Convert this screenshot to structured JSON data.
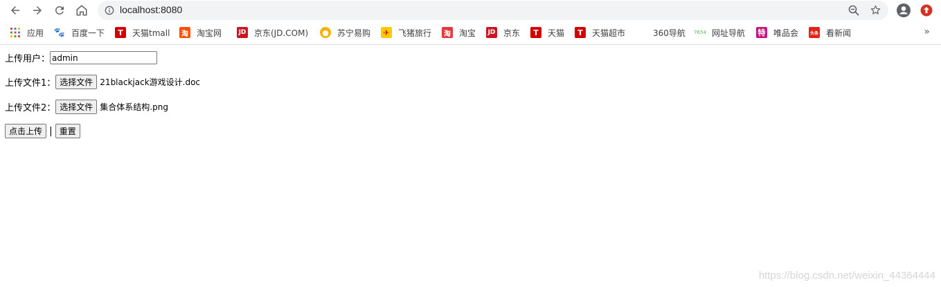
{
  "browser": {
    "url": "localhost:8080",
    "bookmarks": [
      {
        "label": "应用",
        "icon": "apps-grid-icon",
        "color": "#4285f4"
      },
      {
        "label": "百度一下",
        "icon": "baidu-paw-icon",
        "color": "#2932e1"
      },
      {
        "label": "天猫tmall",
        "icon": "tmall-icon",
        "color": "#d50000"
      },
      {
        "label": "淘宝网",
        "icon": "taobao-icon",
        "color": "#ff5000"
      },
      {
        "label": "京东(JD.COM)",
        "icon": "jd-icon",
        "color": "#c81623"
      },
      {
        "label": "苏宁易购",
        "icon": "suning-icon",
        "color": "#f9b000"
      },
      {
        "label": "飞猪旅行",
        "icon": "fliggy-icon",
        "color": "#ffc900"
      },
      {
        "label": "淘宝",
        "icon": "taobao-icon",
        "color": "#e4393c"
      },
      {
        "label": "京东",
        "icon": "jd-icon",
        "color": "#c81623"
      },
      {
        "label": "天猫",
        "icon": "tmall-icon",
        "color": "#d50000"
      },
      {
        "label": "天猫超市",
        "icon": "tmall-icon",
        "color": "#d50000"
      },
      {
        "label": "360导航",
        "icon": "",
        "color": ""
      },
      {
        "label": "网址导航",
        "icon": "7654-icon",
        "color": "#5cb85c"
      },
      {
        "label": "唯品会",
        "icon": "vip-icon",
        "color": "#c4157c"
      },
      {
        "label": "看新闻",
        "icon": "toutiao-icon",
        "color": "#e62117"
      }
    ],
    "bookmarks_more": "»"
  },
  "form": {
    "user_label": "上传用户：",
    "user_value": "admin",
    "file1_label": "上传文件1：",
    "file1_button": "选择文件",
    "file1_name": "21blackjack游戏设计.doc",
    "file2_label": "上传文件2：",
    "file2_button": "选择文件",
    "file2_name": "集合体系结构.png",
    "submit_label": "点击上传",
    "separator": "|",
    "reset_label": "重置"
  },
  "watermark": "https://blog.csdn.net/weixin_44364444"
}
